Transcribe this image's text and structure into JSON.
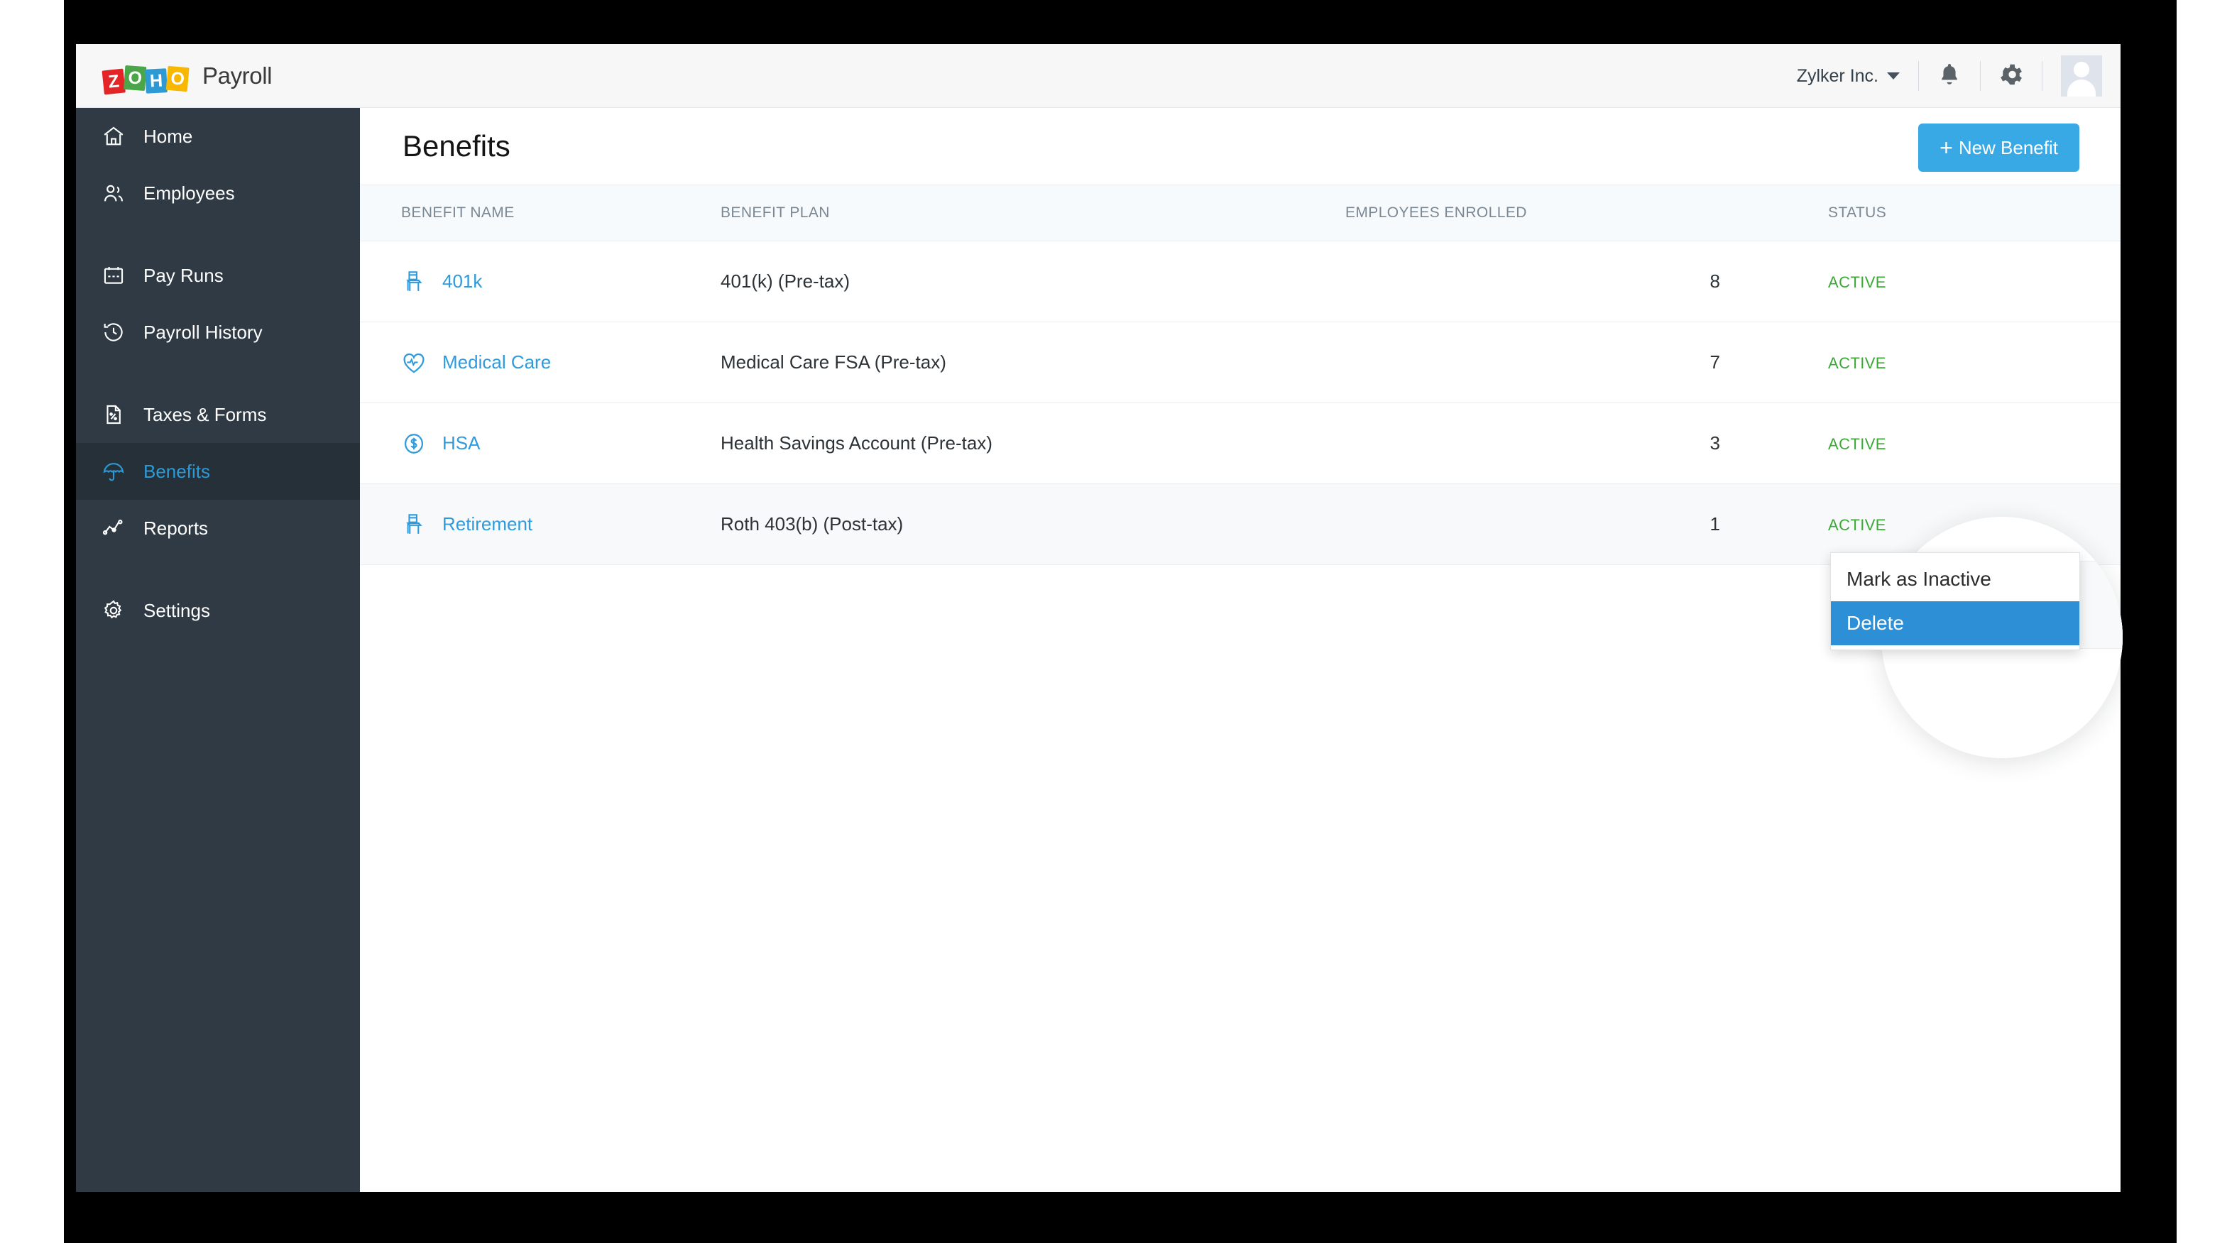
{
  "app": {
    "brand_blocks": [
      "Z",
      "O",
      "H",
      "O"
    ],
    "brand_name": "Payroll"
  },
  "topbar": {
    "org_name": "Zylker Inc.",
    "notifications_icon": "bell-icon",
    "settings_icon": "gear-icon",
    "avatar_icon": "user-avatar"
  },
  "sidebar": {
    "items": [
      {
        "label": "Home",
        "icon": "home-icon",
        "active": false
      },
      {
        "label": "Employees",
        "icon": "people-icon",
        "active": false
      },
      {
        "label": "Pay Runs",
        "icon": "calendar-icon",
        "active": false
      },
      {
        "label": "Payroll History",
        "icon": "clock-history-icon",
        "active": false
      },
      {
        "label": "Taxes & Forms",
        "icon": "document-percent-icon",
        "active": false
      },
      {
        "label": "Benefits",
        "icon": "umbrella-icon",
        "active": true
      },
      {
        "label": "Reports",
        "icon": "line-chart-icon",
        "active": false
      },
      {
        "label": "Settings",
        "icon": "gear-icon",
        "active": false
      }
    ]
  },
  "page": {
    "title": "Benefits",
    "new_button_label": "New Benefit",
    "new_button_plus": "+",
    "accent_color": "#38a9e4"
  },
  "table": {
    "columns": [
      "BENEFIT NAME",
      "BENEFIT PLAN",
      "EMPLOYEES ENROLLED",
      "STATUS"
    ],
    "rows": [
      {
        "name": "401k",
        "icon": "chair-retirement-icon",
        "plan": "401(k) (Pre-tax)",
        "enrolled": "8",
        "status": "ACTIVE",
        "hovered": false
      },
      {
        "name": "Medical Care",
        "icon": "heart-pulse-icon",
        "plan": "Medical Care FSA (Pre-tax)",
        "enrolled": "7",
        "status": "ACTIVE",
        "hovered": false
      },
      {
        "name": "HSA",
        "icon": "dollar-circle-icon",
        "plan": "Health Savings Account (Pre-tax)",
        "enrolled": "3",
        "status": "ACTIVE",
        "hovered": false
      },
      {
        "name": "Retirement",
        "icon": "chair-retirement-icon",
        "plan": "Roth 403(b) (Post-tax)",
        "enrolled": "1",
        "status": "ACTIVE",
        "hovered": true
      }
    ],
    "status_color": "#3aaa35"
  },
  "row_actions": {
    "edit_icon": "pencil-icon",
    "more_icon": "more-horizontal-icon"
  },
  "action_menu": {
    "items": [
      {
        "label": "Mark as Inactive",
        "selected": false
      },
      {
        "label": "Delete",
        "selected": true
      }
    ],
    "highlight_color": "#2d8fd5"
  }
}
